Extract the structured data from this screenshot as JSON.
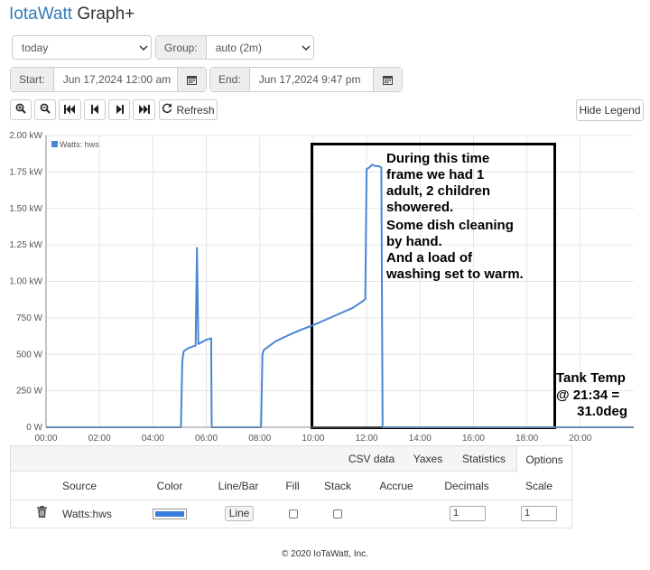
{
  "header": {
    "brand": "IotaWatt",
    "suffix": " Graph+"
  },
  "controls": {
    "period": "today",
    "group_label": "Group:",
    "group_value": "auto (2m)",
    "start_label": "Start:",
    "start_value": "Jun 17,2024 12:00 am",
    "end_label": "End:",
    "end_value": "Jun 17,2024 9:47 pm",
    "refresh_label": "Refresh",
    "hide_legend_label": "Hide Legend"
  },
  "chart_data": {
    "type": "line",
    "yticks": [
      "0 W",
      "250 W",
      "500 W",
      "750 W",
      "1.00 kW",
      "1.25 kW",
      "1.50 kW",
      "1.75 kW",
      "2.00 kW"
    ],
    "xticks": [
      "00:00",
      "02:00",
      "04:00",
      "06:00",
      "08:00",
      "10:00",
      "12:00",
      "14:00",
      "16:00",
      "18:00",
      "20:00"
    ],
    "ylim": [
      0,
      2000
    ],
    "xlim_hours": [
      0,
      22
    ],
    "grid": true,
    "legend_position": "top-left",
    "series": [
      {
        "name": "Watts: hws",
        "color": "#4a86d8",
        "x": [
          0,
          5.05,
          5.1,
          5.15,
          5.3,
          5.5,
          5.6,
          5.65,
          5.7,
          5.8,
          6.0,
          6.1,
          6.18,
          6.2,
          8.05,
          8.1,
          8.15,
          8.3,
          8.6,
          9.0,
          9.5,
          10.0,
          10.5,
          11.0,
          11.5,
          11.9,
          11.95,
          12.0,
          12.1,
          12.2,
          12.35,
          12.45,
          12.55,
          12.6,
          14.0,
          22.0
        ],
        "y": [
          0,
          0,
          450,
          520,
          540,
          555,
          560,
          1230,
          570,
          580,
          600,
          605,
          610,
          0,
          0,
          500,
          530,
          550,
          590,
          625,
          665,
          700,
          740,
          780,
          820,
          870,
          880,
          1770,
          1780,
          1800,
          1790,
          1790,
          1780,
          0,
          0,
          0
        ]
      }
    ],
    "annotations": [
      {
        "lines": [
          "During this time",
          "frame we had 1",
          "adult, 2 children",
          "showered.",
          "Some dish cleaning",
          "by hand.",
          "And a load of",
          "washing set to warm."
        ]
      },
      {
        "lines": [
          "Tank Temp",
          "@ 21:34 =",
          "31.0deg"
        ]
      }
    ]
  },
  "tabs": [
    "CSV data",
    "Yaxes",
    "Statistics",
    "Options"
  ],
  "active_tab": "Options",
  "table": {
    "headers": [
      "Source",
      "Color",
      "Line/Bar",
      "Fill",
      "Stack",
      "Accrue",
      "Decimals",
      "Scale"
    ],
    "row": {
      "source": "Watts:hws",
      "color": "#3b7ddd",
      "line_bar": "Line",
      "fill": false,
      "stack": false,
      "decimals": "1",
      "scale": "1"
    }
  },
  "footer": "© 2020 IoTaWatt, Inc."
}
